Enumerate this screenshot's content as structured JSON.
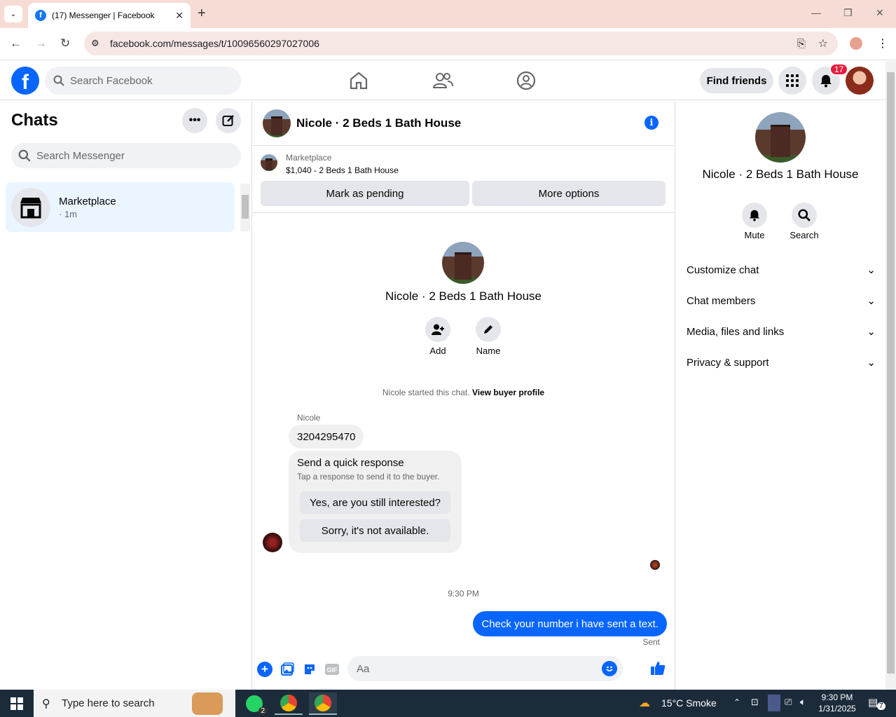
{
  "browser": {
    "tab_title": "(17) Messenger | Facebook",
    "url": "facebook.com/messages/t/10096560297027006"
  },
  "fb": {
    "search_placeholder": "Search Facebook",
    "find_friends": "Find friends",
    "notif_count": "17"
  },
  "left": {
    "title": "Chats",
    "search_placeholder": "Search Messenger",
    "chat": {
      "name": "Marketplace",
      "sub": "· 1m"
    }
  },
  "chat": {
    "title": "Nicole · 2 Beds 1 Bath House",
    "marketplace_label": "Marketplace",
    "listing": "$1,040 - 2 Beds 1 Bath House",
    "mark_pending": "Mark as pending",
    "more_options": "More options",
    "profile_name": "Nicole · 2 Beds 1 Bath House",
    "add_label": "Add",
    "name_label": "Name",
    "started_text": "Nicole started this chat.",
    "view_buyer": "View buyer profile",
    "sender": "Nicole",
    "msg1": "3204295470",
    "quick_title": "Send a quick response",
    "quick_sub": "Tap a response to send it to the buyer.",
    "quick1": "Yes, are you still interested?",
    "quick2": "Sorry, it's not available.",
    "time": "9:30 PM",
    "outgoing": "Check your number i have sent a text.",
    "status": "Sent",
    "composer_placeholder": "Aa"
  },
  "right": {
    "name": "Nicole · 2 Beds 1 Bath House",
    "mute": "Mute",
    "search": "Search",
    "sections": [
      "Customize chat",
      "Chat members",
      "Media, files and links",
      "Privacy & support"
    ]
  },
  "taskbar": {
    "search_placeholder": "Type here to search",
    "whatsapp_badge": "2",
    "weather": "15°C  Smoke",
    "time": "9:30 PM",
    "date": "1/31/2025",
    "notif": "7"
  },
  "colors": {
    "accent": "#0866ff",
    "badge": "#e41e3f"
  }
}
